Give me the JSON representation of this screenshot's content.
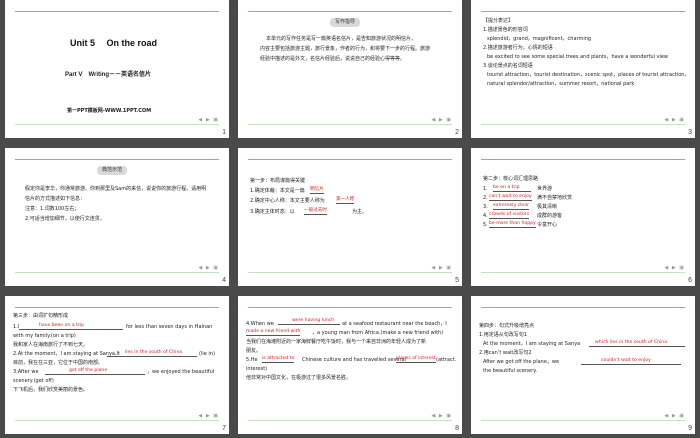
{
  "slides": [
    {
      "num": "1",
      "title": "Unit 5　 On the road",
      "sub": "Part Ⅴ　Writing－－英语名信片",
      "foot": "第一PPT模板网-WWW.1PPT.COM"
    },
    {
      "num": "2",
      "badge": "写作指导",
      "lines": [
        "本单元的写作任务是写一篇英语名信片，是告知旅游状况的明信片。",
        "内容主要包括旅游主题，旅行景象，作者的行为，和将要下一步的行程。旅游",
        "经验中描述的是外文，名信片经验后，说说自己的经验心得等等。"
      ]
    },
    {
      "num": "3",
      "head": "【提分表达】",
      "lines": [
        "1.描述景色的形容词",
        "splendid，grand，magnificent，charming",
        "2.描述旅游者行为，心情的短语",
        "be excited to see some special trees and plants，have a wonderful view",
        "3.谈论景点的名词短语",
        "tourist attraction，tourist destination，scenic spot，places of tourist attraction，",
        "natural splendor/attraction，summer resort，national park"
      ]
    },
    {
      "num": "4",
      "badge": "典范示范",
      "lines": [
        "假定你是李华，你通常旅游。你到那里及Sam的来信，说说你的旅游行程。请用明",
        "信片的方式描述如下信息：",
        "注意：1.词数100左右；",
        "2.可适当增加细节，以使行文连贯。"
      ]
    },
    {
      "num": "5",
      "head": "第一步：布局谋篇得关键",
      "lines": [
        "1.确定体裁：本文是一篇",
        "2.确定中心人称：本文主要人称为",
        "3.确定主体时态：以",
        "为主。"
      ],
      "answers": [
        "明信片",
        "第一人称",
        "一般过去时"
      ]
    },
    {
      "num": "6",
      "head": "第二步：核心词汇理思路",
      "lines": [
        "世界游",
        "满不自禁地欣赏",
        "极其清晰",
        "成群的游客",
        "你自得的"
      ],
      "answers": [
        "be on a trip",
        "can’t wait to enjoy",
        "extremely clear",
        "crowds of visitors",
        "be more than happy"
      ],
      "extra": "令富开心"
    },
    {
      "num": "7",
      "head": "第三步：由词扩句精形成",
      "lines": [
        "1.I",
        "for less than seven days in Hainan",
        "with my family.(on a trip)",
        "我和家人在海南旅行了不到七天。",
        "2.At the moment，I am staying at Sanya,It",
        "(lie in)",
        "目前，我在在三亚，它位于中国的南部。",
        "3.After we",
        "，we enjoyed the beautiful",
        "scenery.(get off)",
        "下飞机后，我们欣赏美丽的景色。"
      ],
      "answers": [
        "have been on a trip",
        "lies in the south of China",
        "got off the plane"
      ]
    },
    {
      "num": "8",
      "head": "",
      "lines": [
        "4.When we",
        "at a seafood restaurant near the beach，I",
        "，a young man from Africa.(make a new friend with)",
        "当我们在海滩附近的一家海鲜餐厅吃午饭时，我与一个来自非洲的年轻人成为了新",
        "朋友。",
        "5.He",
        "Chinese culture and has travelled several",
        "(attract.",
        "interest)",
        "他非常对中国文化，在极游过了很多风景名胜。"
      ],
      "answers": [
        "were having lunch",
        "made a new friend with",
        "is attracted to",
        "places of interest"
      ]
    },
    {
      "num": "9",
      "head": "第四步：句式升级增亮点",
      "lines": [
        "1.用定语从句改写句1",
        "At the moment，I am staying at Sanya",
        "2.用can’t wait改写句2",
        "After we got off the plane，we",
        "the beautiful scenery."
      ],
      "answers": [
        "which lies in the south of China",
        "couldn’t wait to enjoy"
      ]
    }
  ]
}
